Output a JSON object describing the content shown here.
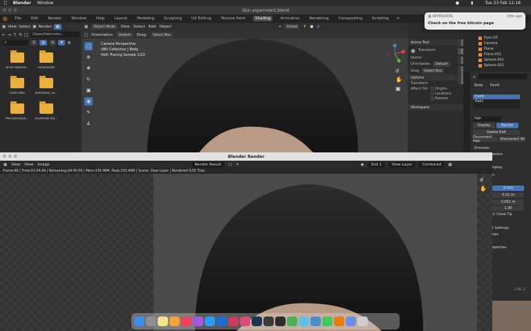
{
  "menubar": {
    "apple": "",
    "app": "Blender",
    "window": "Window",
    "datetime": "Tue 23 Feb  12:18"
  },
  "main_window": {
    "title": "Skin experiment.blend"
  },
  "topbar": {
    "menus": [
      "File",
      "Edit",
      "Render",
      "Window",
      "Help"
    ],
    "workspaces": [
      "Layout",
      "Modeling",
      "Sculpting",
      "UV Editing",
      "Texture Paint",
      "Shading",
      "Animation",
      "Rendering",
      "Compositing",
      "Scripting"
    ],
    "active_workspace": "Shading"
  },
  "file_browser": {
    "menus": [
      "View",
      "Select"
    ],
    "render_label": "Render",
    "path": "/Users/fabricioto...",
    "folders": [
      "drive-downlo...",
      "FaceAssets",
      "",
      "Fotos Mac",
      "keentools_fa...",
      "",
      "MarvelousDe...",
      "multimat-ma...",
      ""
    ]
  },
  "viewport": {
    "mode": "Object Mode",
    "menus": [
      "View",
      "Select",
      "Add",
      "Object"
    ],
    "orientation_label": "Orientation",
    "orientation_value": "Default",
    "drag_label": "Drag:",
    "drag_value": "Select Box",
    "transform_global": "Global",
    "info": [
      "Camera Perspective",
      "(88) Collection | Body",
      "Path Tracing Sample 1/32"
    ],
    "tool_icons": [
      "select-box",
      "cursor",
      "move",
      "rotate",
      "scale",
      "transform",
      "annotate",
      "measure"
    ]
  },
  "npanel": {
    "active_tool_label": "Active Tool",
    "transform_label": "Transform",
    "gizmo_label": "Gizmo",
    "orientation_label": "Orientation",
    "orientation_value": "Default",
    "drag_label": "Drag",
    "drag_value": "Select Box",
    "options_label": "Options",
    "transform_sub": "Transform",
    "affect_only_label": "Affect Onl",
    "checkboxes": [
      "Origins",
      "Locations",
      "Parents"
    ],
    "workspace_label": "Workspace",
    "tabs": [
      "Item",
      "Tool",
      "View",
      "HairStrands"
    ]
  },
  "outliner": {
    "items": [
      "Eyes.00",
      "Camera",
      "Plane",
      "Plane.001",
      "Sphere.001",
      "Sphere.002"
    ]
  },
  "properties": {
    "object_name": "Body",
    "hair_tab": "HairR",
    "particle_slots": [
      "HairR",
      "HairL"
    ],
    "hair_label": "Hair",
    "display_label": "Display",
    "render_label": "Render",
    "delete_edit": "Delete Edit",
    "disconnect_hair": "Disconnect Hair",
    "disconnect_all": "Disconnect All",
    "emission_label": "Emission",
    "dynamics_label": "amics",
    "isplay_label": "isplay",
    "value_1": "0.000",
    "value_2": "0.01 m",
    "value_3": "0.001 m",
    "value_4": "1.00",
    "close_tip": "Close Tip",
    "settings_label": "t Settings",
    "ups_label": "ups",
    "operties_label": "operties",
    "version": "2.91.2",
    "n_label": "n"
  },
  "notification": {
    "app": "REMINDERS",
    "time": "18m ago",
    "message": "Check on the free bitcoin page"
  },
  "render_window": {
    "title": "Blender Render",
    "menus": [
      "View",
      "View",
      "Image"
    ],
    "image_name": "Render Result",
    "slot": "Slot 1",
    "view_layer": "View Layer",
    "combined": "Combined",
    "status": "Frame:88 | Time:01:04.49 | Remaining:04:40.59 | Mem:330.46M, Peak:330.46M | Scene, View Layer | Rendered 5/35 Tiles"
  },
  "dock": {
    "apps": [
      {
        "name": "finder",
        "color": "#3d8ee8"
      },
      {
        "name": "launchpad",
        "color": "#8e8e93"
      },
      {
        "name": "notes",
        "color": "#f5e28a"
      },
      {
        "name": "photos",
        "color": "#f0a23c"
      },
      {
        "name": "music",
        "color": "#f0435b"
      },
      {
        "name": "podcasts",
        "color": "#a25be0"
      },
      {
        "name": "twitter",
        "color": "#2b9cf0"
      },
      {
        "name": "affinity-designer",
        "color": "#1a6fd6"
      },
      {
        "name": "affinity-publisher",
        "color": "#c83d5f"
      },
      {
        "name": "affinity-photo",
        "color": "#d94e7a"
      },
      {
        "name": "lightroom-classic",
        "color": "#1f3450"
      },
      {
        "name": "final-cut",
        "color": "#3a3a3a"
      },
      {
        "name": "davinci",
        "color": "#2c2c2c"
      },
      {
        "name": "chrome",
        "color": "#4caf50"
      },
      {
        "name": "maps",
        "color": "#60c0e8"
      },
      {
        "name": "preview",
        "color": "#4a90c8"
      },
      {
        "name": "messages",
        "color": "#43c85a"
      },
      {
        "name": "blender",
        "color": "#e87d0d"
      },
      {
        "name": "folder",
        "color": "#6b8fe8"
      },
      {
        "name": "trash",
        "color": "#cfcfcf"
      }
    ]
  }
}
